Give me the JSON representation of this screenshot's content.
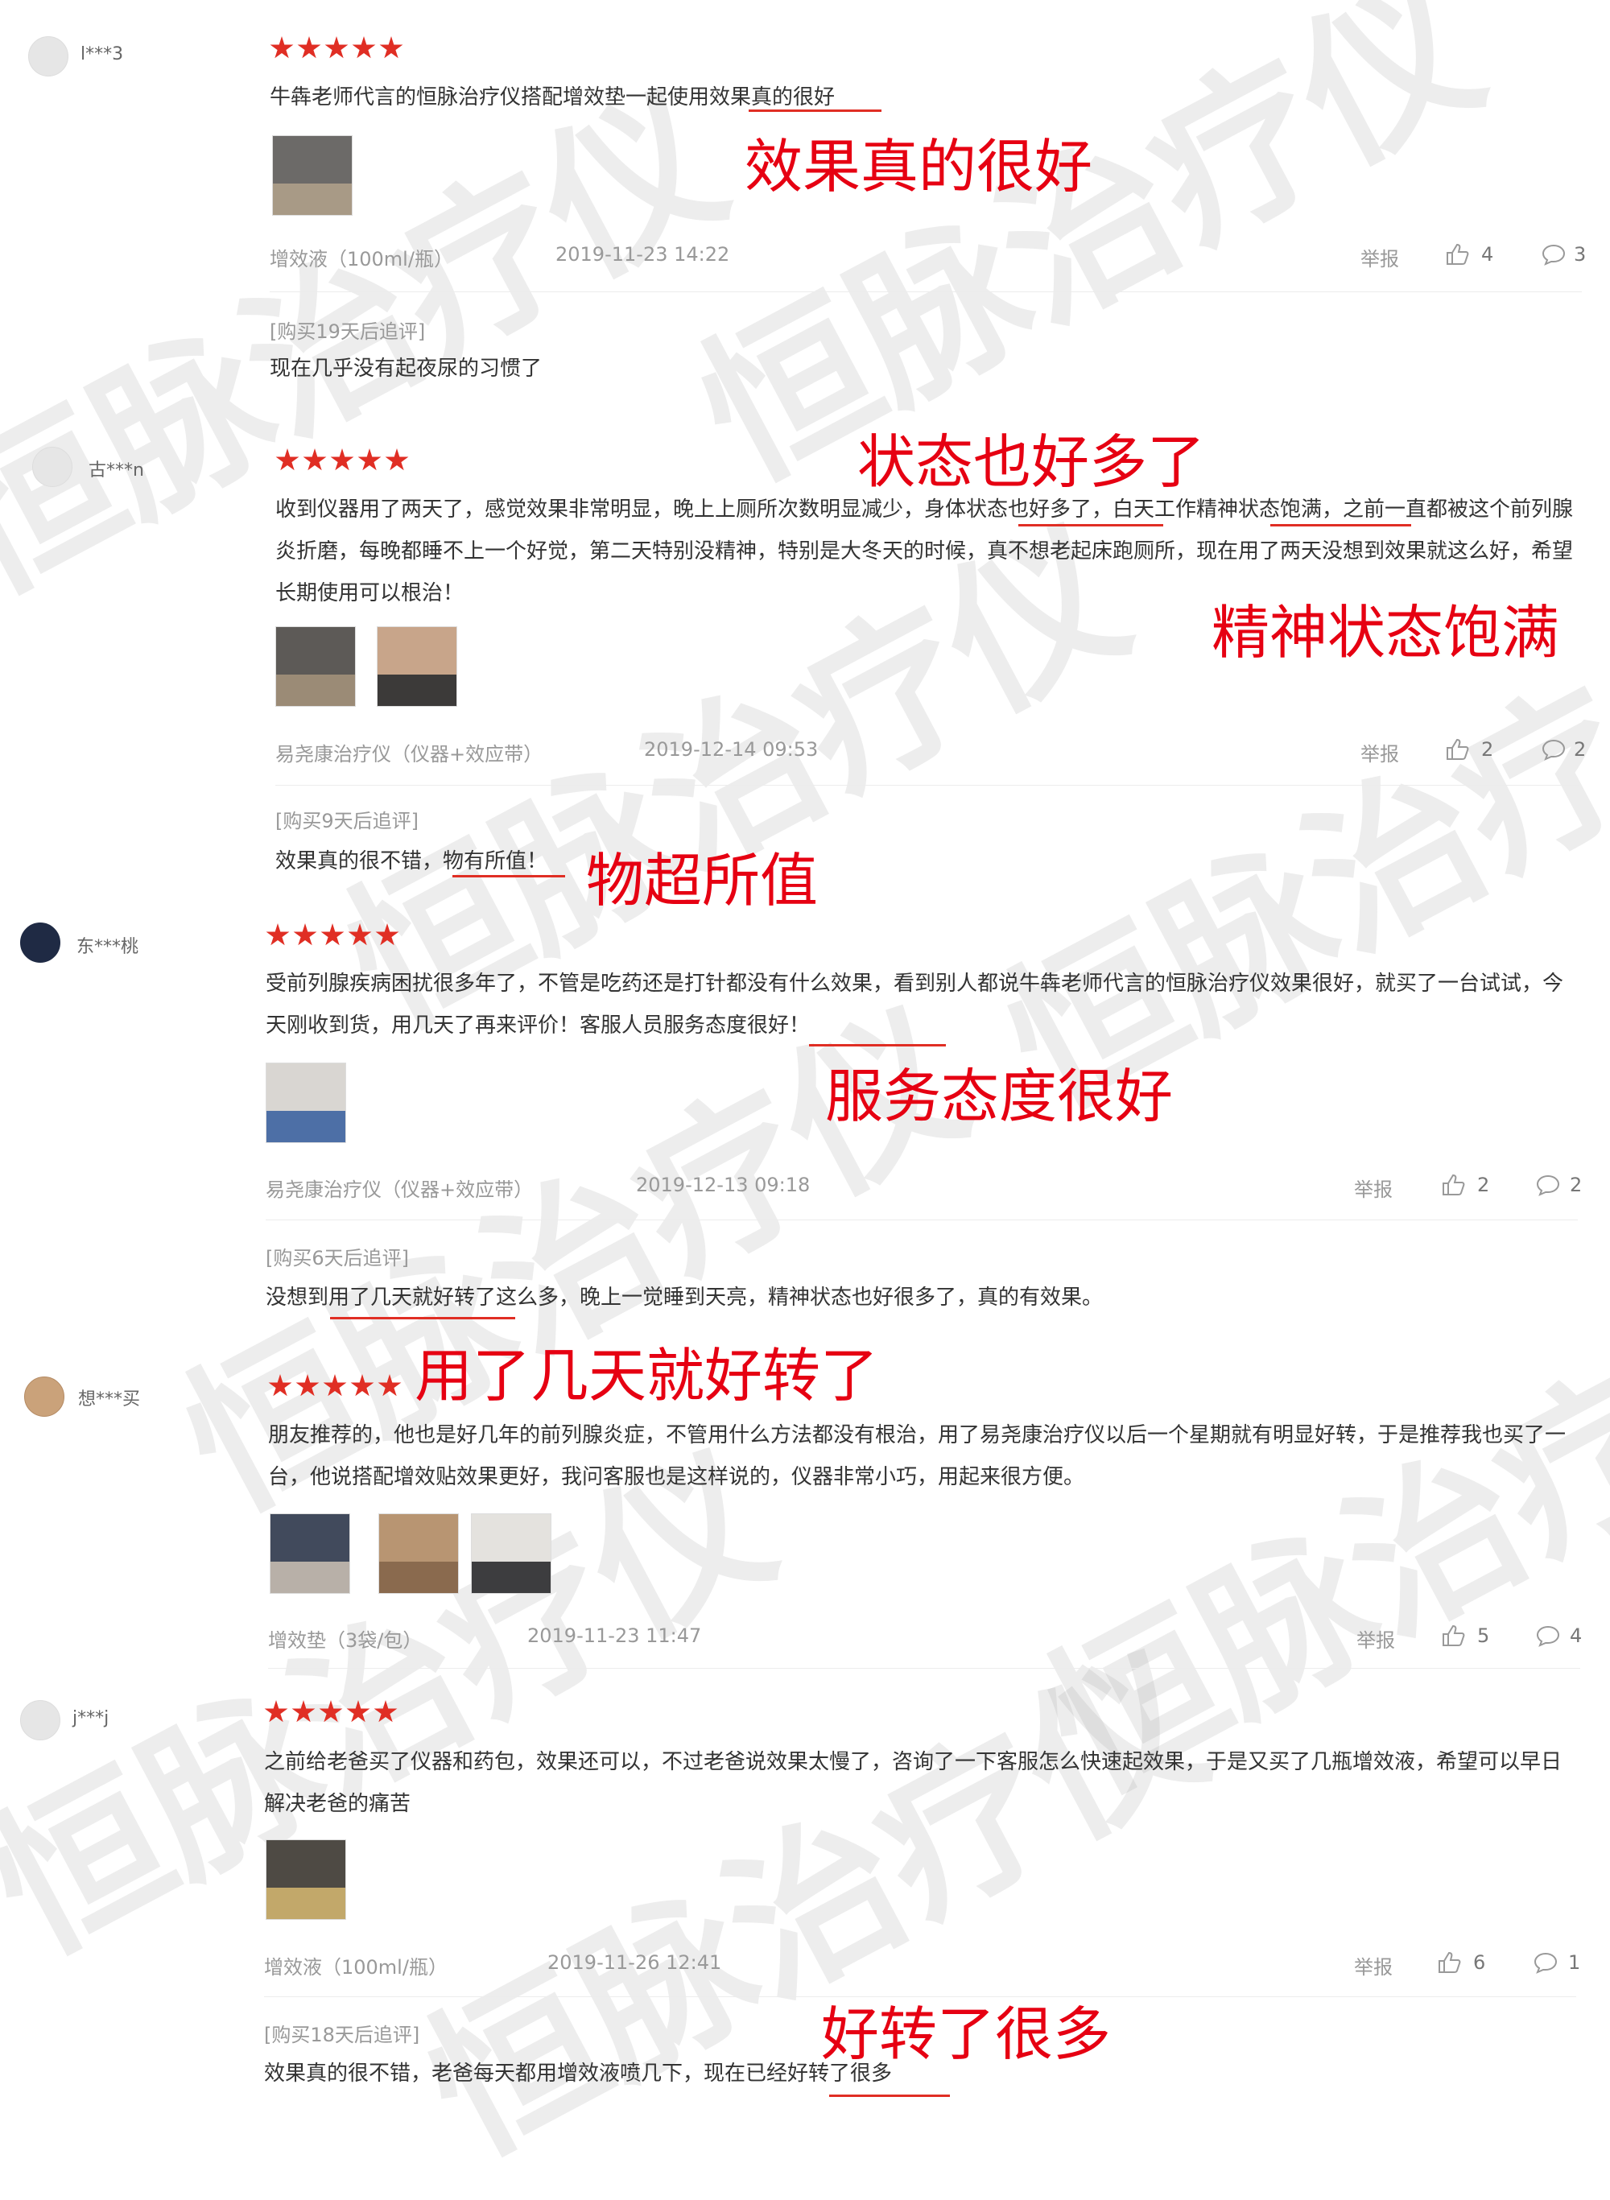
{
  "watermark": "恒脉治疗仪",
  "report_label": "举报",
  "reviews": [
    {
      "user": "l***3",
      "text": "牛犇老师代言的恒脉治疗仪搭配增效垫一起使用效果真的很好",
      "sku": "增效液（100ml/瓶）",
      "date": "2019-11-23 14:22",
      "likes": "4",
      "comments": "3",
      "followup_tag": "[购买19天后追评]",
      "followup_text": "现在几乎没有起夜尿的习惯了"
    },
    {
      "user": "古***n",
      "text": "收到仪器用了两天了，感觉效果非常明显，晚上上厕所次数明显减少，身体状态也好多了，白天工作精神状态饱满，之前一直都被这个前列腺炎折磨，每晚都睡不上一个好觉，第二天特别没精神，特别是大冬天的时候，真不想老起床跑厕所，现在用了两天没想到效果就这么好，希望长期使用可以根治！",
      "sku": "易尧康治疗仪（仪器+效应带）",
      "date": "2019-12-14 09:53",
      "likes": "2",
      "comments": "2",
      "followup_tag": "[购买9天后追评]",
      "followup_text": "效果真的很不错，物有所值！"
    },
    {
      "user": "东***桃",
      "text": "受前列腺疾病困扰很多年了，不管是吃药还是打针都没有什么效果，看到别人都说牛犇老师代言的恒脉治疗仪效果很好，就买了一台试试，今天刚收到货，用几天了再来评价！客服人员服务态度很好！",
      "sku": "易尧康治疗仪（仪器+效应带）",
      "date": "2019-12-13 09:18",
      "likes": "2",
      "comments": "2",
      "followup_tag": "[购买6天后追评]",
      "followup_text": "没想到用了几天就好转了这么多，晚上一觉睡到天亮，精神状态也好很多了，真的有效果。"
    },
    {
      "user": "想***买",
      "text": "朋友推荐的，他也是好几年的前列腺炎症，不管用什么方法都没有根治，用了易尧康治疗仪以后一个星期就有明显好转，于是推荐我也买了一台，他说搭配增效贴效果更好，我问客服也是这样说的，仪器非常小巧，用起来很方便。",
      "sku": "增效垫（3袋/包）",
      "date": "2019-11-23 11:47",
      "likes": "5",
      "comments": "4"
    },
    {
      "user": "j***j",
      "text": "之前给老爸买了仪器和药包，效果还可以，不过老爸说效果太慢了，咨询了一下客服怎么快速起效果，于是又买了几瓶增效液，希望可以早日解决老爸的痛苦",
      "sku": "增效液（100ml/瓶）",
      "date": "2019-11-26 12:41",
      "likes": "6",
      "comments": "1",
      "followup_tag": "[购买18天后追评]",
      "followup_text": "效果真的很不错，老爸每天都用增效液喷几下，现在已经好转了很多"
    }
  ],
  "callouts": {
    "c1": "效果真的很好",
    "c2": "状态也好多了",
    "c3": "精神状态饱满",
    "c4": "物超所值",
    "c5": "服务态度很好",
    "c6": "用了几天就好转了",
    "c7": "好转了很多"
  },
  "colors": {
    "accent": "#e02e24",
    "callout": "#e60012"
  }
}
